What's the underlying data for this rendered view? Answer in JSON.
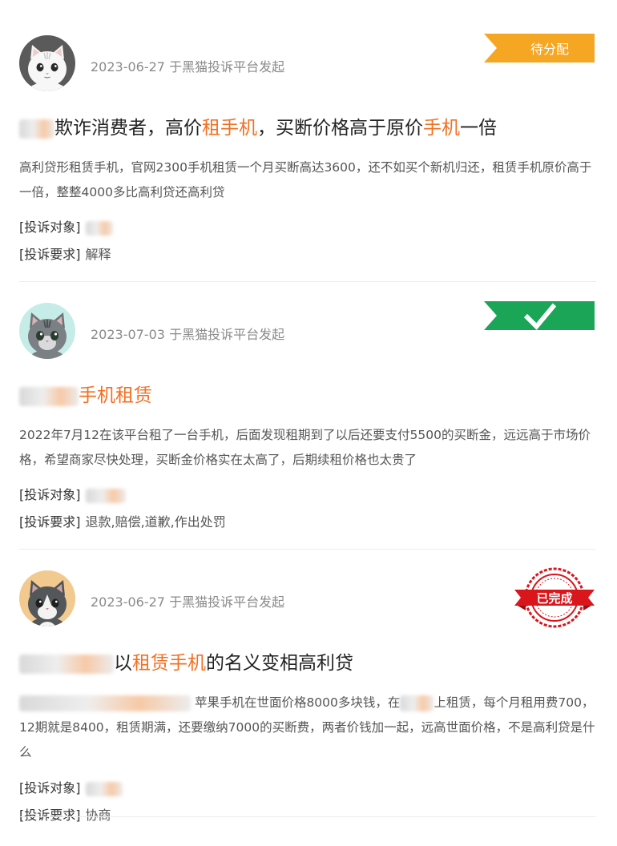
{
  "complaints": [
    {
      "meta": "2023-06-27 于黑猫投诉平台发起",
      "status": {
        "label": "待分配",
        "color": "#f5a623"
      },
      "title_parts": [
        "欺诈消费者，高价",
        "租手机",
        "，买断价格高于原价",
        "手机",
        "一倍"
      ],
      "description": "高利贷形租赁手机，官网2300手机租赁一个月买断高达3600，还不如买个新机归还，租赁手机原价高于一倍，整整4000多比高利贷还高利贷",
      "target_label": "[投诉对象]",
      "request_label": "[投诉要求]",
      "request_value": "解释",
      "avatar": "white-cat-avatar"
    },
    {
      "meta": "2023-07-03 于黑猫投诉平台发起",
      "status": {
        "label": "已回复",
        "color": "#1aa557"
      },
      "title_parts": [
        "手机租赁"
      ],
      "description": "2022年7月12在该平台租了一台手机，后面发现租期到了以后还要支付5500的买断金，远远高于市场价格，希望商家尽快处理，买断金价格实在太高了，后期续租价格也太贵了",
      "target_label": "[投诉对象]",
      "request_label": "[投诉要求]",
      "request_value": "退款,赔偿,道歉,作出处罚",
      "avatar": "grey-tabby-cat-avatar"
    },
    {
      "meta": "2023-06-27 于黑猫投诉平台发起",
      "status": {
        "label": "已完成",
        "color": "#d9161c"
      },
      "title_parts": [
        "以",
        "租赁手机",
        "的名义变相高利贷"
      ],
      "description_parts": [
        "苹果手机在世面价格8000多块钱，在",
        "上租赁，每个月租用费700，12期就是8400，租赁期满，还要缴纳7000的买断费，两者价钱加一起，远高世面价格，不是高利贷是什么"
      ],
      "target_label": "[投诉对象]",
      "request_label": "[投诉要求]",
      "request_value": "协商",
      "avatar": "grey-white-cat-avatar"
    }
  ]
}
